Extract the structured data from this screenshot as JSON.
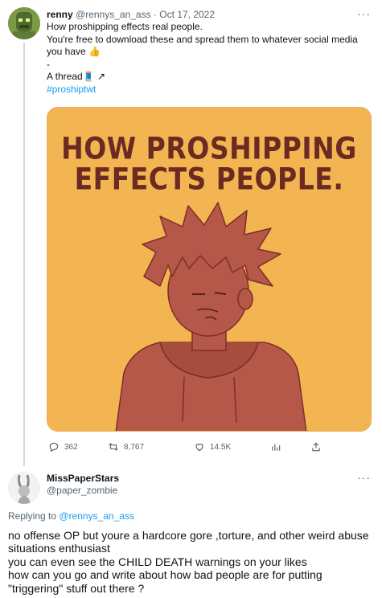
{
  "tweet1": {
    "name": "renny",
    "handle": "@rennys_an_ass",
    "separator": "·",
    "date": "Oct 17, 2022",
    "more": "···",
    "lines": [
      "How proshipping effects real people.",
      "You're free to download these and spread them to whatever social media you have 👍",
      "-",
      "A thread🧵 ↗"
    ],
    "hashtag": "#proshiptwt",
    "image_text": {
      "line1": "HOW PROSHIPPING",
      "line2": "EFFECTS PEOPLE."
    },
    "stats": {
      "replies": "362",
      "retweets": "8,767",
      "likes": "14.5K"
    },
    "colors": {
      "image_bg": "#f3b552",
      "image_title": "#6b2a22",
      "figure": "#b5584a",
      "link": "#1d9bf0"
    }
  },
  "tweet2": {
    "name": "MissPaperStars",
    "handle": "@paper_zombie",
    "more": "···",
    "replying_prefix": "Replying to ",
    "replying_handle": "@rennys_an_ass",
    "lines": [
      "no offense OP but youre a hardcore gore ,torture, and other weird abuse situations enthusiast",
      "you can even see the CHILD DEATH warnings on your likes",
      "how can you go and write about how bad people are for putting \"triggering\" stuff out there ?"
    ]
  }
}
